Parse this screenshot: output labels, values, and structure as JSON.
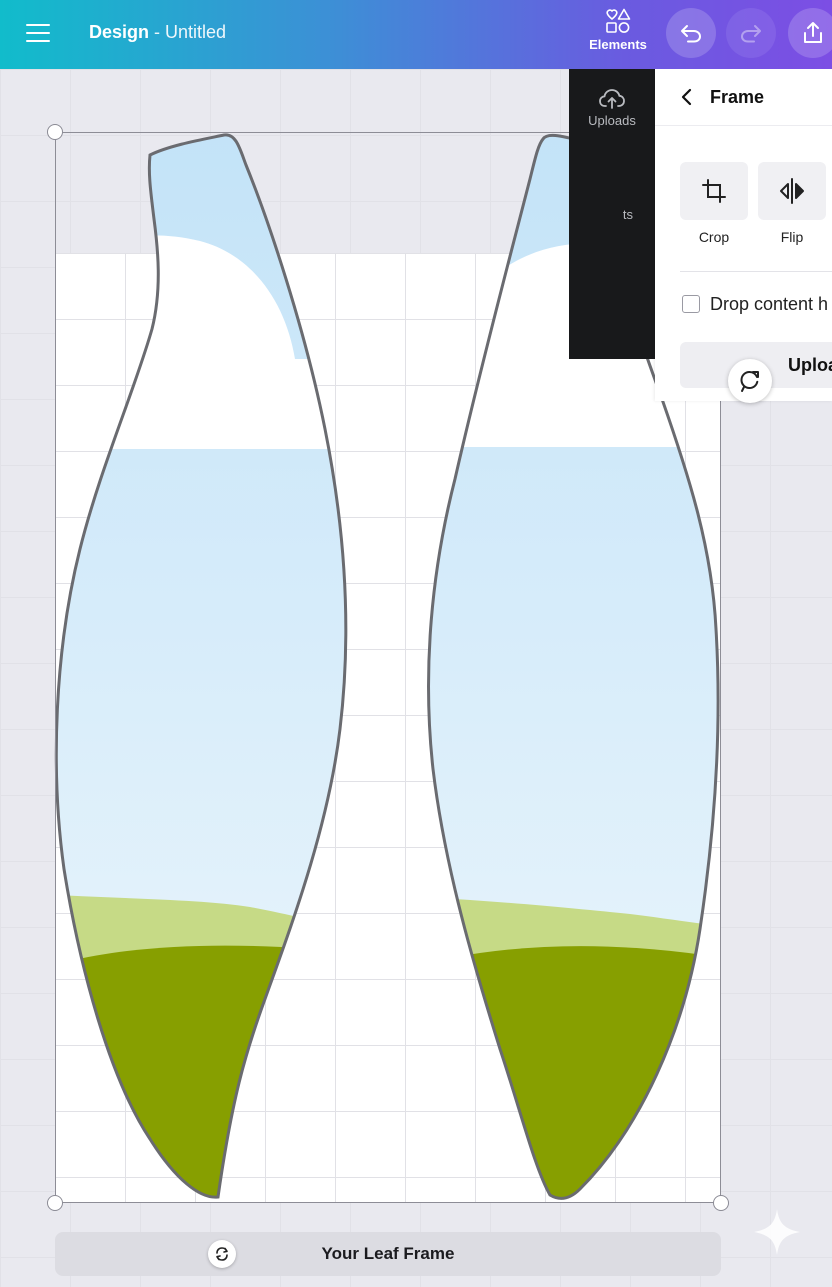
{
  "topbar": {
    "title_bold": "Design",
    "title_sep": " - ",
    "title_doc": "Untitled",
    "elements_label": "Elements"
  },
  "side": {
    "uploads_label": "Uploads",
    "other_label_fragment": "ts"
  },
  "panel": {
    "title": "Frame",
    "crop_label": "Crop",
    "flip_label": "Flip",
    "drop_label": "Drop content h",
    "upload_label": "Uploa"
  },
  "frame": {
    "label": "Your Leaf Frame"
  },
  "colors": {
    "sky_top": "#c3e3f8",
    "sky_bottom": "#eef7fc",
    "cloud": "#ffffff",
    "hill_light": "#c6da86",
    "hill_dark": "#879f00",
    "outline": "#6a6b70"
  },
  "icons": [
    "menu-icon",
    "elements-icon",
    "undo-icon",
    "redo-icon",
    "share-icon",
    "cloud-upload-icon",
    "chevron-left-icon",
    "crop-icon",
    "flip-icon",
    "checkbox-icon",
    "rotate-icon",
    "swap-icon",
    "sparkle-icon"
  ]
}
